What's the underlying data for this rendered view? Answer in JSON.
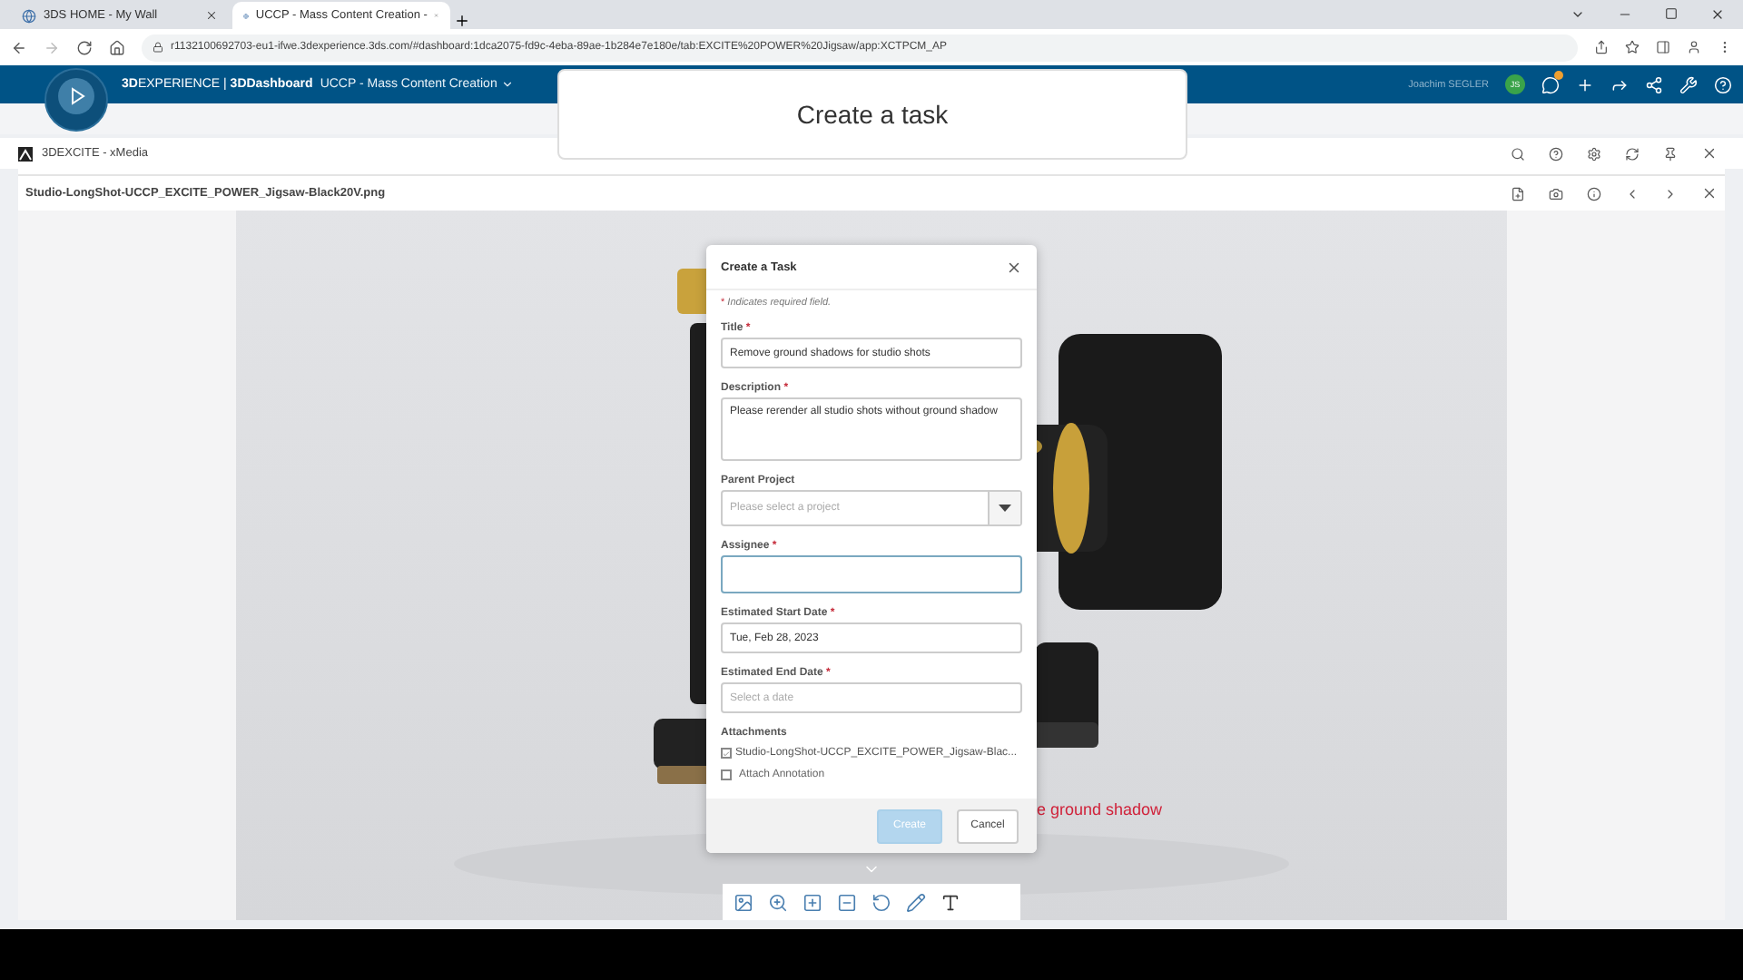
{
  "browser": {
    "tabs": [
      {
        "label": "3DS HOME - My Wall",
        "selected": false
      },
      {
        "label": "UCCP - Mass Content Creation -",
        "selected": true
      }
    ],
    "url": "r1132100692703-eu1-ifwe.3dexperience.3ds.com/#dashboard:1dca2075-fd9c-4eba-89ae-1b284e7e180e/tab:EXCITE%20POWER%20Jigsaw/app:XCTPCM_AP"
  },
  "header": {
    "brand": "**3D**EXPERIENCE | **3DDashboard**",
    "dashboard": "UCCP - Mass Content Creation",
    "user": "Joachim SEGLER",
    "user_initials": "JS",
    "notification_badge": true
  },
  "overlay_title": "Create a task",
  "panel": {
    "title": "3DEXCITE - xMedia",
    "file": "Studio-LongShot-UCCP_EXCITE_POWER_Jigsaw-Black20V.png",
    "annotation": "e ground shadow"
  },
  "dialog": {
    "title": "Create a Task",
    "required_mark": "*",
    "note": "Indicates required field.",
    "fields": [
      {
        "kind": "text",
        "label": "Title",
        "required": true,
        "focused": false,
        "value": "Remove ground shadows for studio shots"
      },
      {
        "kind": "textarea",
        "label": "Description",
        "required": true,
        "focused": false,
        "value": "Please rerender all studio shots without ground shadow"
      },
      {
        "kind": "select",
        "label": "Parent Project",
        "required": false,
        "focused": false,
        "placeholder": "Please select a project"
      },
      {
        "kind": "text",
        "label": "Assignee",
        "required": true,
        "focused": true
      },
      {
        "kind": "text",
        "label": "Estimated Start Date",
        "required": true,
        "focused": false,
        "value": "Tue, Feb 28, 2023"
      },
      {
        "kind": "text",
        "label": "Estimated End Date",
        "required": true,
        "focused": false,
        "placeholder": "Select a date"
      }
    ],
    "attachments": {
      "label": "Attachments",
      "items": [
        {
          "name": "Studio-LongShot-UCCP_EXCITE_POWER_Jigsaw-Blac...",
          "checked": true
        }
      ]
    },
    "options": [
      {
        "label": "Attach Annotation",
        "checked": false
      }
    ],
    "buttons": [
      {
        "label": "Create",
        "kind": "primary",
        "disabled": true
      },
      {
        "label": "Cancel",
        "kind": "secondary",
        "disabled": false
      }
    ]
  }
}
